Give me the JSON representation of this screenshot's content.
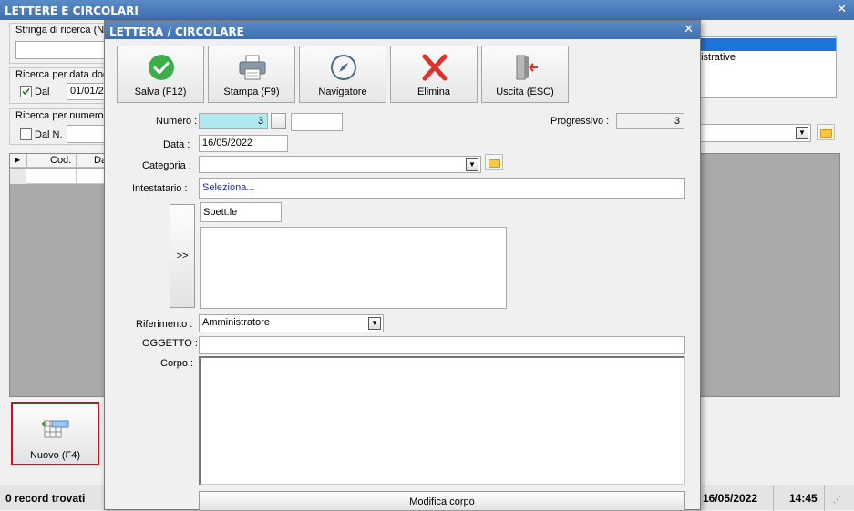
{
  "main_window": {
    "title": "LETTERE E CIRCOLARI",
    "search_label": "Stringa di ricerca (Nu",
    "date_group_label": "Ricerca per data doc",
    "date_checkbox_label": "Dal",
    "date_from_value": "01/01/2",
    "number_group_label": "Ricerca per numero",
    "number_checkbox_label": "Dal N.",
    "grid_columns": [
      "Cod.",
      "Da"
    ],
    "list_item": "nistrative",
    "new_button_label": "Nuovo (F4)",
    "status_records": "0 record trovati",
    "status_date": "16/05/2022",
    "status_time": "14:45"
  },
  "dialog": {
    "title": "LETTERA / CIRCOLARE",
    "toolbar": [
      {
        "label": "Salva (F12)",
        "icon": "check-circle-icon"
      },
      {
        "label": "Stampa (F9)",
        "icon": "printer-icon"
      },
      {
        "label": "Navigatore",
        "icon": "compass-icon"
      },
      {
        "label": "Elimina",
        "icon": "red-x-icon"
      },
      {
        "label": "Uscita (ESC)",
        "icon": "exit-door-icon"
      }
    ],
    "numero_label": "Numero :",
    "numero_value": "3",
    "progressivo_label": "Progressivo :",
    "progressivo_value": "3",
    "data_label": "Data :",
    "data_value": "16/05/2022",
    "categoria_label": "Categoria :",
    "categoria_value": "",
    "intestatario_label": "Intestatario :",
    "intestatario_value": "Seleziona...",
    "arrow_button_label": ">>",
    "spett_value": "Spett.le",
    "riferimento_label": "Riferimento :",
    "riferimento_value": "Amministratore",
    "oggetto_label": "OGGETTO :",
    "oggetto_value": "",
    "corpo_label": "Corpo :",
    "corpo_value": "",
    "modifica_button_label": "Modifica corpo"
  },
  "colors": {
    "titlebar": "#4a7cbe",
    "highlight_field": "#aeeaf0",
    "selection": "#1e74d6",
    "new_button_border": "#c8141e"
  }
}
